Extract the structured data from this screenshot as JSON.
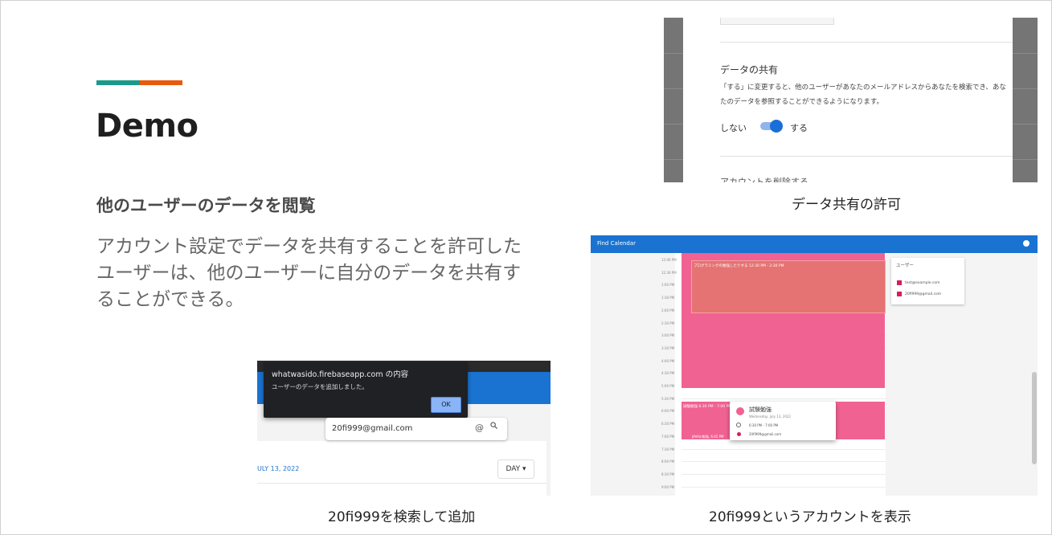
{
  "colors": {
    "accent_teal": "#1b9a8a",
    "accent_orange": "#e8590c",
    "brand_blue": "#1a73d0",
    "event_pink": "#f06292"
  },
  "slide": {
    "title": "Demo",
    "subtitle": "他のユーザーのデータを閲覧",
    "body": "アカウント設定でデータを共有することを許可したユーザーは、他のユーザーに自分のデータを共有することができる。"
  },
  "settings_shot": {
    "heading": "データの共有",
    "description": "「する」に変更すると、他のユーザーがあなたのメールアドレスからあなたを検索でき、あなたのデータを参照することができるようになります。",
    "toggle_off_label": "しない",
    "toggle_on_label": "する",
    "toggle_state": "on",
    "cut_text": "アカウントを削除する",
    "caption": "データ共有の許可"
  },
  "search_shot": {
    "dialog_title": "whatwasido.firebaseapp.com の内容",
    "dialog_message": "ユーザーのデータを追加しました。",
    "dialog_ok": "OK",
    "search_value": "20fi999@gmail.com",
    "date_label": "ULY 13, 2022",
    "view_select": "DAY ▾",
    "caption": "20fi999を検索して追加"
  },
  "calendar_shot": {
    "app_title": "Find Calendar",
    "time_labels": [
      "12:00 PM",
      "12:30 PM",
      "1:00 PM",
      "1:30 PM",
      "2:00 PM",
      "2:30 PM",
      "3:00 PM",
      "3:30 PM",
      "4:00 PM",
      "4:30 PM",
      "5:00 PM",
      "5:30 PM",
      "6:00 PM",
      "6:30 PM",
      "7:00 PM",
      "7:30 PM",
      "8:00 PM",
      "8:30 PM",
      "9:00 PM"
    ],
    "event_block_1": "プログラミングの勉強したりする  12:30 PM - 2:30 PM",
    "event_block_2": "試験勉強  6:30 PM - 7:00 PM",
    "event_block_2_sub": "JAVAの勉強, 6:45 PM",
    "users_panel_title": "ユーザー",
    "users": [
      "test@example.com",
      "20fi999@gmail.com"
    ],
    "popup": {
      "title": "試験勉強",
      "date": "Wednesday, July 13, 2022",
      "time": "6:30 PM - 7:00 PM",
      "owner": "20fi999@gmail.com"
    },
    "caption": "20fi999というアカウントを表示"
  }
}
